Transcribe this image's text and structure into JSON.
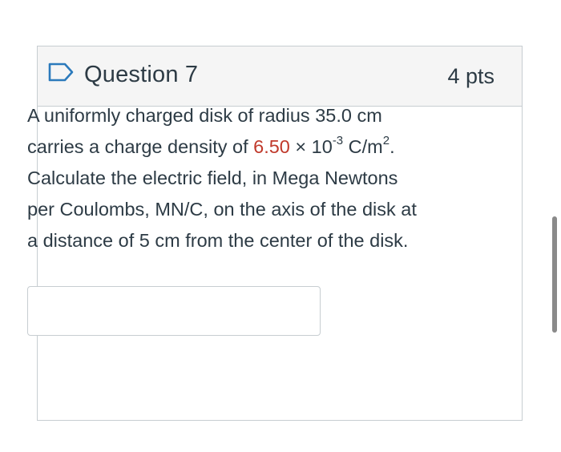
{
  "question": {
    "title": "Question 7",
    "points": "4 pts",
    "body": {
      "line1": "A uniformly charged disk of radius 35.0 cm",
      "line2_pre": "carries a charge density of ",
      "line2_value": "6.50",
      "line2_times": " × 10",
      "line2_exp": "-3",
      "line2_unit": " C/m",
      "line2_unit_exp": "2",
      "line2_end": ".",
      "line3": "Calculate the electric field, in Mega Newtons",
      "line4": "per Coulombs, MN/C,  on the axis of the disk at",
      "line5": "a distance of 5 cm from the center of the disk."
    },
    "answer_value": ""
  },
  "colors": {
    "variable_value": "#c0392b",
    "text": "#2d3b45",
    "header_bg": "#f5f5f5",
    "border": "#c7cdd1",
    "flag_stroke": "#2b7abc"
  },
  "icons": {
    "flag": "flag-question-icon"
  }
}
